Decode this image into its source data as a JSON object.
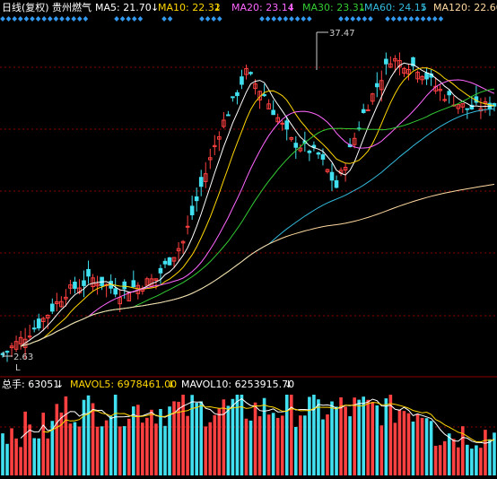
{
  "header": {
    "period_label": "日线(复权)",
    "stock_name": "贵州燃气",
    "ma": [
      {
        "label": "MA5: 21.70",
        "color": "#ffffff"
      },
      {
        "label": "MA10: 22.32",
        "color": "#ffd700"
      },
      {
        "label": "MA20: 23.14",
        "color": "#ff66ff"
      },
      {
        "label": "MA30: 23.31",
        "color": "#33cc33"
      },
      {
        "label": "MA60: 24.15",
        "color": "#33bbdd"
      },
      {
        "label": "MA120: 22.60",
        "color": "#ffd9a0"
      }
    ],
    "arrow_symbol": "↓"
  },
  "volume_header": {
    "total_label": "总手: 63051",
    "mavol5_label": "MAVOL5: 6978461.00",
    "mavol10_label": "MAVOL10: 6253915.70"
  },
  "annotations": {
    "high_label": "37.47",
    "low_label": "2.63",
    "low_marker": "L"
  },
  "colors": {
    "up": "#ff4040",
    "down": "#40e0f0",
    "grid": "#8b0000",
    "text": "#ffffff",
    "diamond": "#3399ee"
  },
  "chart_data": {
    "type": "candlestick",
    "title": "贵州燃气 日线(复权)",
    "ylim": [
      2.63,
      37.47
    ],
    "grid": true,
    "high": 37.47,
    "low": 2.63,
    "legend": "top",
    "moving_averages": {
      "MA5": 21.7,
      "MA10": 22.32,
      "MA20": 23.14,
      "MA30": 23.31,
      "MA60": 24.15,
      "MA120": 22.6
    },
    "volume": {
      "total": 63051,
      "MAVOL5": 6978461.0,
      "MAVOL10": 6253915.7
    }
  }
}
